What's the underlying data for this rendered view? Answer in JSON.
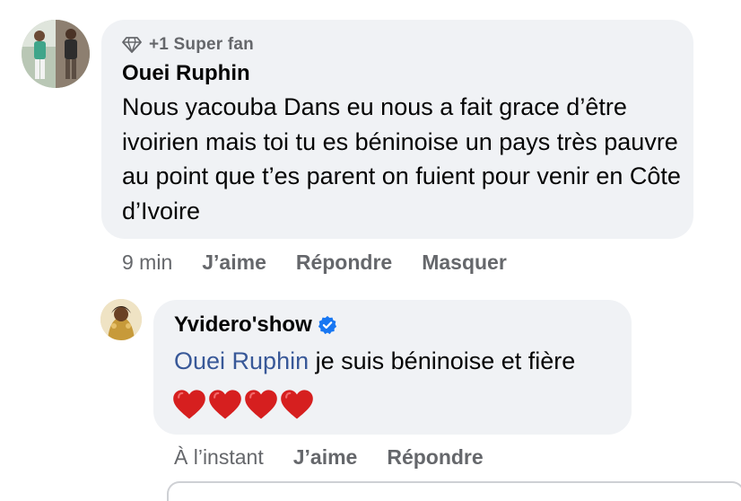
{
  "comment": {
    "badge": "+1 Super fan",
    "author": "Ouei Ruphin",
    "text": "Nous yacouba Dans eu nous a fait grace d’être ivoirien mais toi tu es béninoise un pays très pauvre au point que t’es parent on fuient pour venir en Côte d’Ivoire",
    "time": "9 min",
    "actions": {
      "like": "J’aime",
      "reply": "Répondre",
      "hide": "Masquer"
    }
  },
  "reply": {
    "author": "Yvidero'show",
    "mention": "Ouei Ruphin",
    "text": "je suis béninoise et fière",
    "emoji_count": 4,
    "time": "À l’instant",
    "actions": {
      "like": "J’aime",
      "reply": "Répondre"
    }
  },
  "colors": {
    "bubble": "#f0f2f5",
    "meta_text": "#65676b",
    "mention": "#385898",
    "verified": "#1877f2",
    "heart": "#d61f1f"
  }
}
